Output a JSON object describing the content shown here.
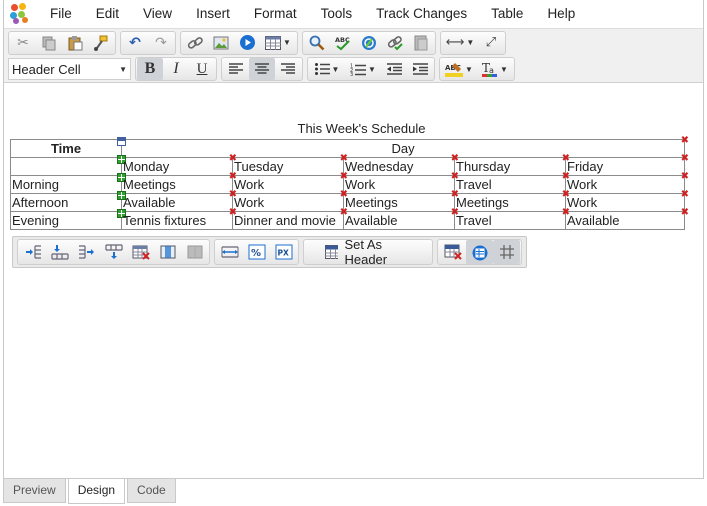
{
  "menu": [
    "File",
    "Edit",
    "View",
    "Insert",
    "Format",
    "Tools",
    "Track Changes",
    "Table",
    "Help"
  ],
  "toolbar": {
    "paragraph_style": "Header Cell",
    "bold": "B",
    "italic": "I",
    "underline": "U"
  },
  "document": {
    "caption": "This Week's Schedule",
    "header": {
      "time": "Time",
      "day": "Day"
    },
    "days": [
      "Monday",
      "Tuesday",
      "Wednesday",
      "Thursday",
      "Friday"
    ],
    "rows": [
      {
        "label": "Morning",
        "cells": [
          "Meetings",
          "Work",
          "Work",
          "Travel",
          "Work"
        ]
      },
      {
        "label": "Afternoon",
        "cells": [
          "Available",
          "Work",
          "Meetings",
          "Meetings",
          "Work"
        ]
      },
      {
        "label": "Evening",
        "cells": [
          "Tennis fixtures",
          "Dinner and movie",
          "Available",
          "Travel",
          "Available"
        ]
      }
    ]
  },
  "table_toolbar": {
    "set_as_header": "Set As Header"
  },
  "tabs": [
    "Preview",
    "Design",
    "Code"
  ],
  "active_tab": "Design",
  "colors": {
    "toolbar_bg": "#f0f0f0",
    "delete_mark": "#d02020",
    "add_mark": "#2fa02f"
  }
}
